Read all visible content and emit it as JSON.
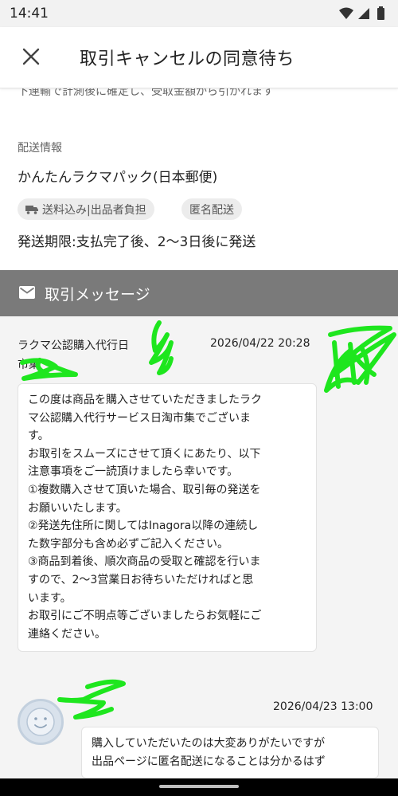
{
  "status_bar": {
    "time": "14:41"
  },
  "header": {
    "title": "取引キャンセルの同意待ち"
  },
  "cut_text": "下連輸で計測後に確定し、受取金額から引かれます",
  "delivery": {
    "section_label": "配送情報",
    "method": "かんたんラクマパック(日本郵便)",
    "chips": [
      "送料込み|出品者負担",
      "匿名配送"
    ],
    "deadline": "発送期限:支払完了後、2〜3日後に発送"
  },
  "messages": {
    "header": "取引メッセージ",
    "items": [
      {
        "sender": "ラクマ公認購入代行日",
        "sender_sub": "市集",
        "timestamp": "2026/04/22 20:28",
        "lines": [
          "この度は商品を購入させていただきましたラク",
          "マ公認購入代行サービス日淘市集でございま",
          "す。",
          "お取引をスムーズにさせて頂くにあたり、以下",
          "注意事項をご一読頂けましたら幸いです。",
          "①複数購入させて頂いた場合、取引毎の発送を",
          "お願いいたします。",
          "②発送先住所に関してはInagora以降の連続し",
          "た数字部分も含め必ずご記入ください。",
          "③商品到着後、順次商品の受取と確認を行いま",
          "すので、2〜3営業日お待ちいただければと思",
          "います。",
          "お取引にご不明点等ございましたらお気軽にご",
          "連絡ください。"
        ]
      },
      {
        "timestamp": "2026/04/23 13:00",
        "lines": [
          "購入していただいたのは大変ありがたいですが",
          "出品ページに匿名配送になることは分かるはず"
        ]
      }
    ]
  },
  "colors": {
    "band": "#7a7a7a",
    "scribble": "#1ee61e",
    "chip_bg": "#ececec",
    "message_bg": "#f4f4f4"
  }
}
